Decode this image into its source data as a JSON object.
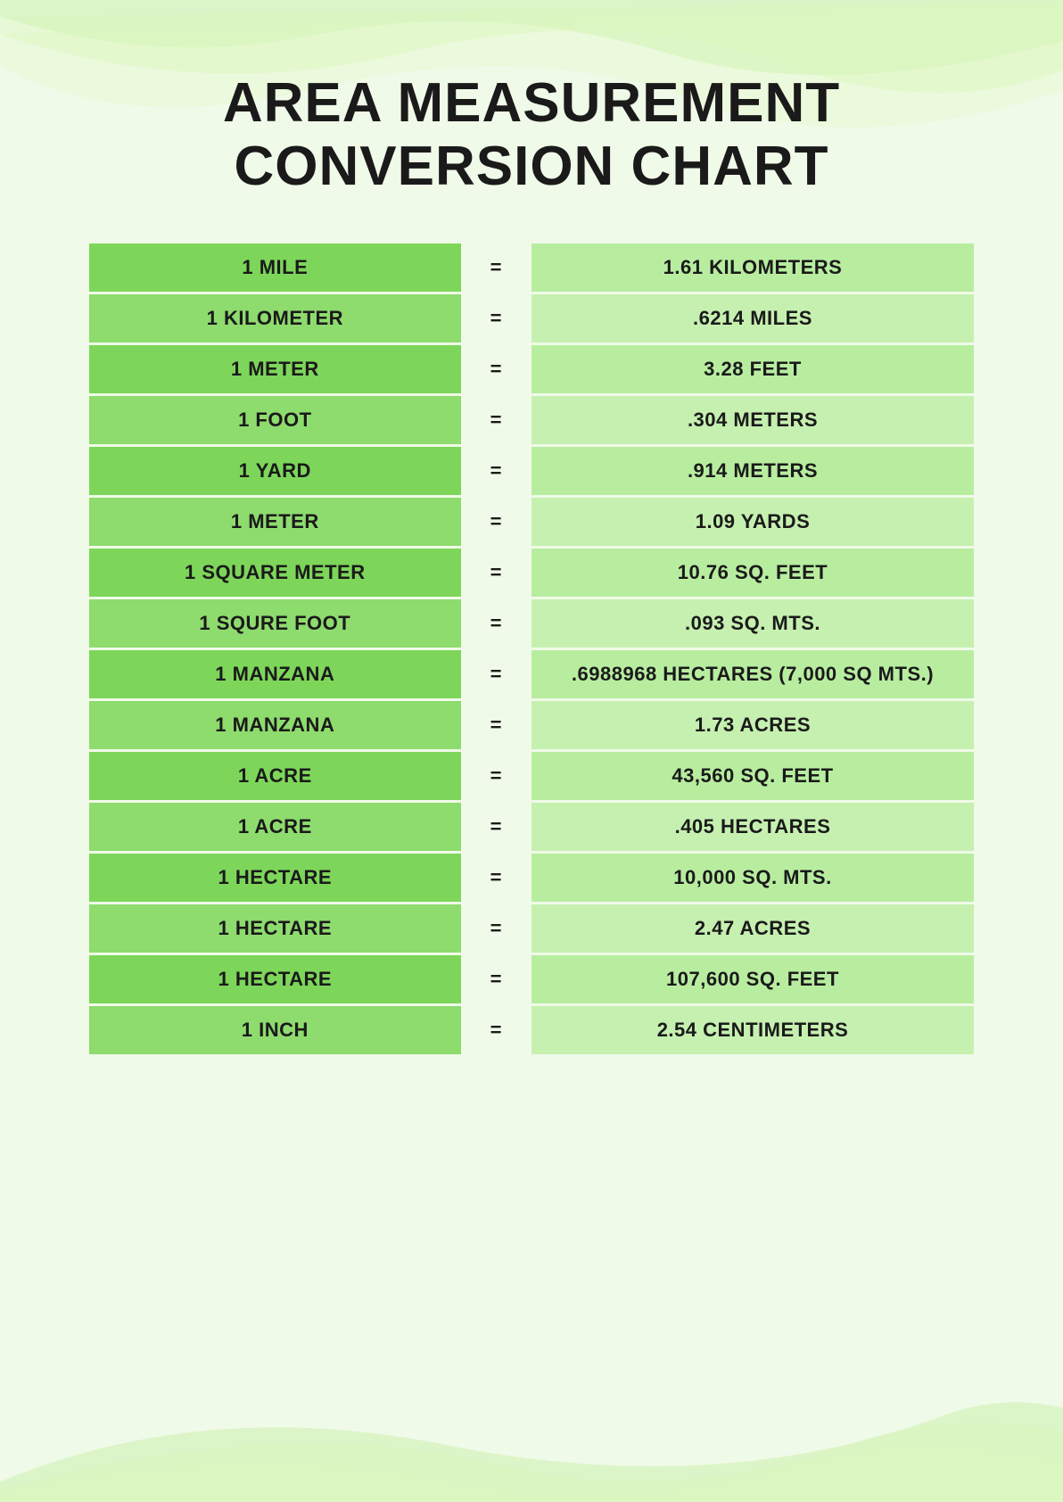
{
  "page": {
    "title_line1": "AREA MEASUREMENT",
    "title_line2": "CONVERSION CHART",
    "bg_color": "#f0fae8",
    "accent_dark": "#7dd65a",
    "accent_light": "#b8eda0"
  },
  "rows": [
    {
      "left": "1 MILE",
      "eq": "=",
      "right": "1.61 KILOMETERS"
    },
    {
      "left": "1 KILOMETER",
      "eq": "=",
      "right": ".6214 MILES"
    },
    {
      "left": "1 METER",
      "eq": "=",
      "right": "3.28 FEET"
    },
    {
      "left": "1 FOOT",
      "eq": "=",
      "right": ".304 METERS"
    },
    {
      "left": "1 YARD",
      "eq": "=",
      "right": ".914 METERS"
    },
    {
      "left": "1 METER",
      "eq": "=",
      "right": "1.09 YARDS"
    },
    {
      "left": "1 SQUARE METER",
      "eq": "=",
      "right": "10.76 SQ. FEET"
    },
    {
      "left": "1 SQURE FOOT",
      "eq": "=",
      "right": ".093 SQ. MTS."
    },
    {
      "left": "1 MANZANA",
      "eq": "=",
      "right": ".6988968 HECTARES (7,000 SQ MTS.)"
    },
    {
      "left": "1 MANZANA",
      "eq": "=",
      "right": "1.73 ACRES"
    },
    {
      "left": "1 ACRE",
      "eq": "=",
      "right": "43,560 SQ. FEET"
    },
    {
      "left": "1 ACRE",
      "eq": "=",
      "right": ".405 HECTARES"
    },
    {
      "left": "1 HECTARE",
      "eq": "=",
      "right": "10,000 SQ. MTS."
    },
    {
      "left": "1 HECTARE",
      "eq": "=",
      "right": "2.47 ACRES"
    },
    {
      "left": "1 HECTARE",
      "eq": "=",
      "right": "107,600 SQ. FEET"
    },
    {
      "left": "1 INCH",
      "eq": "=",
      "right": "2.54 CENTIMETERS"
    }
  ]
}
